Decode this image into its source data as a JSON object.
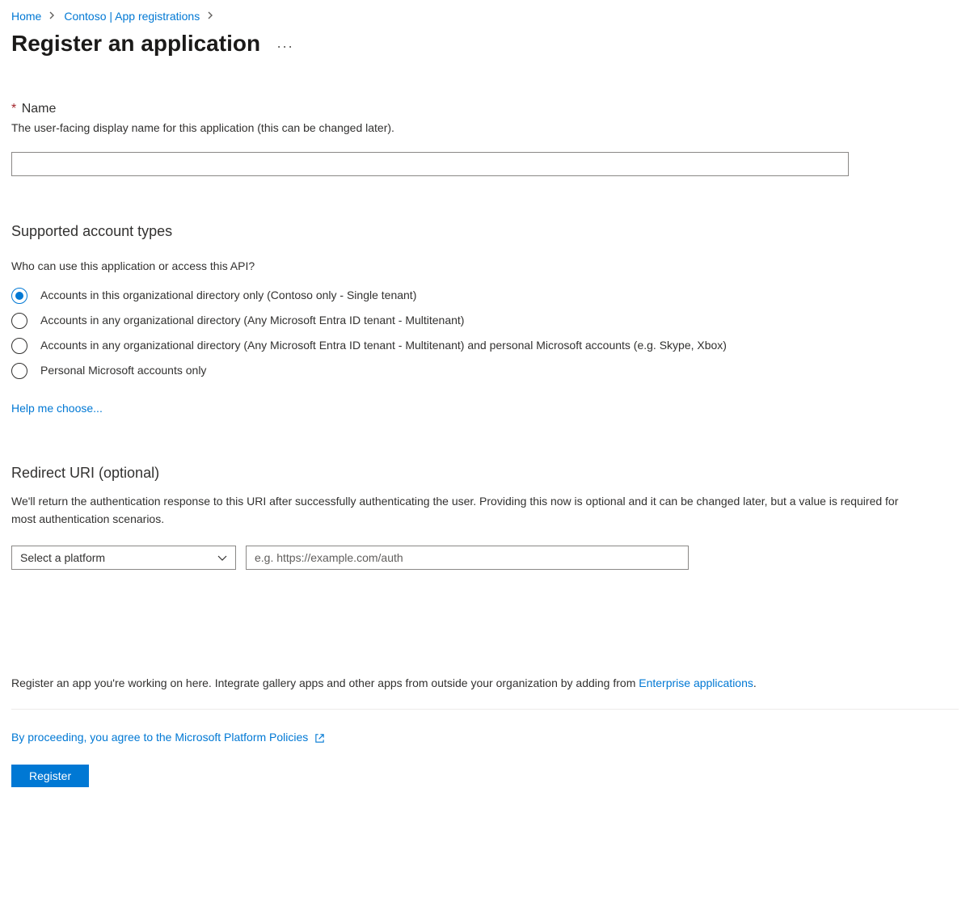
{
  "breadcrumb": {
    "home": "Home",
    "app_registrations": "Contoso | App registrations"
  },
  "page_title": "Register an application",
  "name_section": {
    "star": "*",
    "label": "Name",
    "help": "The user-facing display name for this application (this can be changed later)."
  },
  "account_types": {
    "heading": "Supported account types",
    "subtext": "Who can use this application or access this API?",
    "options": [
      "Accounts in this organizational directory only (Contoso only - Single tenant)",
      "Accounts in any organizational directory (Any Microsoft Entra ID tenant - Multitenant)",
      "Accounts in any organizational directory (Any Microsoft Entra ID tenant - Multitenant) and personal Microsoft accounts (e.g. Skype, Xbox)",
      "Personal Microsoft accounts only"
    ],
    "help_link": "Help me choose..."
  },
  "redirect": {
    "heading": "Redirect URI (optional)",
    "description": "We'll return the authentication response to this URI after successfully authenticating the user. Providing this now is optional and it can be changed later, but a value is required for most authentication scenarios.",
    "platform_placeholder": "Select a platform",
    "uri_placeholder": "e.g. https://example.com/auth"
  },
  "bottom_note": {
    "prefix": "Register an app you're working on here. Integrate gallery apps and other apps from outside your organization by adding from ",
    "link": "Enterprise applications",
    "suffix": "."
  },
  "policies_link": "By proceeding, you agree to the Microsoft Platform Policies",
  "register_button": "Register"
}
